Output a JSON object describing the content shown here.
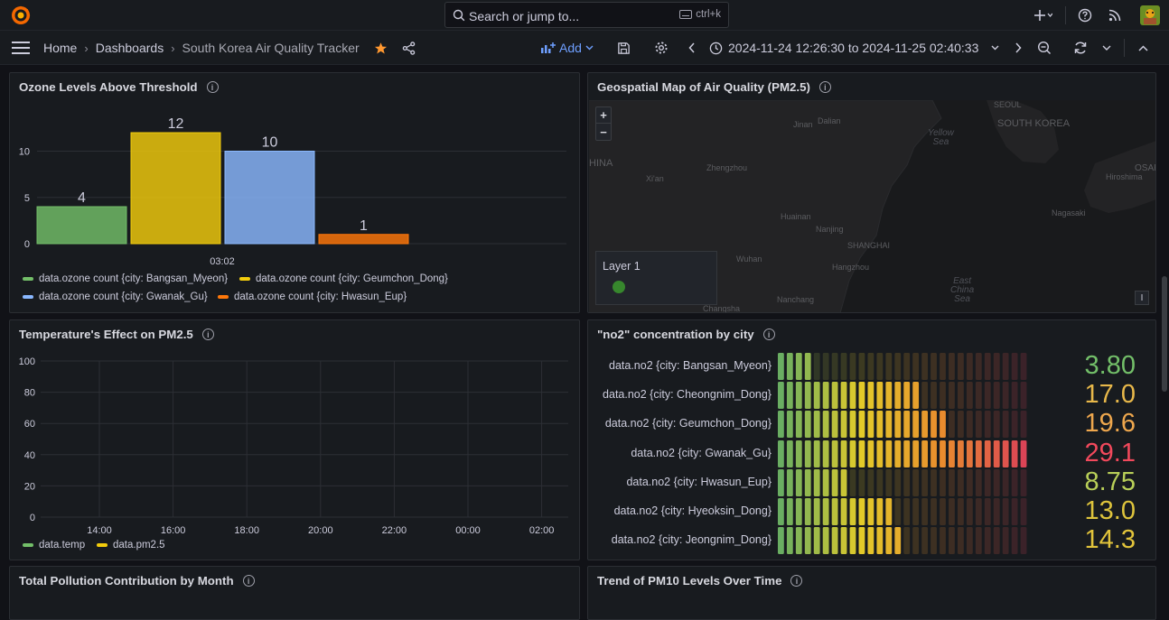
{
  "search": {
    "placeholder": "Search or jump to...",
    "shortcut": "ctrl+k"
  },
  "breadcrumb": {
    "home": "Home",
    "dashboards": "Dashboards",
    "current": "South Korea Air Quality Tracker"
  },
  "toolbar": {
    "add_label": "Add"
  },
  "time_range": {
    "text": "2024-11-24 12:26:30 to 2024-11-25 02:40:33"
  },
  "colors": {
    "green": "#73bf69",
    "yellow": "#f2cc0c",
    "blue": "#8ab8ff",
    "orange": "#ff780a",
    "red": "#f2495c"
  },
  "panels": {
    "ozone": {
      "title": "Ozone Levels Above Threshold",
      "x_tick": "03:02",
      "y_ticks": [
        "0",
        "5",
        "10"
      ],
      "legend": [
        "data.ozone count {city: Bangsan_Myeon}",
        "data.ozone count {city: Geumchon_Dong}",
        "data.ozone count {city: Gwanak_Gu}",
        "data.ozone count {city: Hwasun_Eup}"
      ]
    },
    "map": {
      "title": "Geospatial Map of Air Quality (PM2.5)",
      "layer_label": "Layer 1",
      "zoom_in": "+",
      "zoom_out": "−",
      "tool": "I",
      "places": {
        "seoul": "SEOUL",
        "south_korea": "SOUTH KOREA",
        "jinan": "Jinan",
        "dalian": "Dalian",
        "zhengzhou": "Zhengzhou",
        "xian": "Xi'an",
        "huainan": "Huainan",
        "nanjing": "Nanjing",
        "shanghai": "SHANGHAI",
        "wuhan": "Wuhan",
        "hangzhou": "Hangzhou",
        "nanchang": "Nanchang",
        "changsha": "Changsha",
        "hiroshima": "Hiroshima",
        "osaka": "OSAKA",
        "nagasaki": "Nagasaki",
        "china": "HINA",
        "yellow_sea_1": "Yellow",
        "yellow_sea_2": "Sea",
        "east_china_sea_1": "East",
        "east_china_sea_2": "China",
        "east_china_sea_3": "Sea"
      }
    },
    "temp": {
      "title": "Temperature's Effect on PM2.5",
      "y_ticks": [
        "100",
        "80",
        "60",
        "40",
        "20",
        "0"
      ],
      "x_ticks": [
        "14:00",
        "16:00",
        "18:00",
        "20:00",
        "22:00",
        "00:00",
        "02:00"
      ],
      "legend": [
        "data.temp",
        "data.pm2.5"
      ]
    },
    "no2": {
      "title": "\"no2\" concentration by city",
      "rows": [
        {
          "label": "data.no2 {city: Bangsan_Myeon}",
          "value": "3.80",
          "num": 3.8,
          "color": "#73bf69"
        },
        {
          "label": "data.no2 {city: Cheongnim_Dong}",
          "value": "17.0",
          "num": 17.0,
          "color": "#e8b84a"
        },
        {
          "label": "data.no2 {city: Geumchon_Dong}",
          "value": "19.6",
          "num": 19.6,
          "color": "#eea74d"
        },
        {
          "label": "data.no2 {city: Gwanak_Gu}",
          "value": "29.1",
          "num": 29.1,
          "color": "#f2495c"
        },
        {
          "label": "data.no2 {city: Hwasun_Eup}",
          "value": "8.75",
          "num": 8.75,
          "color": "#b8cf58"
        },
        {
          "label": "data.no2 {city: Hyeoksin_Dong}",
          "value": "13.0",
          "num": 13.0,
          "color": "#dec43c"
        },
        {
          "label": "data.no2 {city: Jeongnim_Dong}",
          "value": "14.3",
          "num": 14.3,
          "color": "#e2c43b"
        }
      ]
    },
    "pollution": {
      "title": "Total Pollution Contribution by Month"
    },
    "pm10": {
      "title": "Trend of PM10 Levels Over Time"
    }
  },
  "chart_data": {
    "type": "bar",
    "title": "Ozone Levels Above Threshold",
    "categories": [
      "03:02"
    ],
    "series": [
      {
        "name": "data.ozone count {city: Bangsan_Myeon}",
        "values": [
          4
        ],
        "color": "#73bf69"
      },
      {
        "name": "data.ozone count {city: Geumchon_Dong}",
        "values": [
          12
        ],
        "color": "#f2cc0c"
      },
      {
        "name": "data.ozone count {city: Gwanak_Gu}",
        "values": [
          10
        ],
        "color": "#8ab8ff"
      },
      {
        "name": "data.ozone count {city: Hwasun_Eup}",
        "values": [
          1
        ],
        "color": "#ff780a"
      }
    ],
    "ylim": [
      0,
      12
    ],
    "grid": true,
    "legend": "bottom"
  }
}
